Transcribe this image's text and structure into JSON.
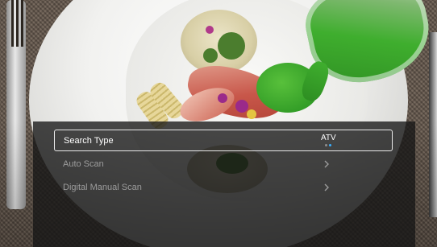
{
  "menu": {
    "items": [
      {
        "label": "Search Type",
        "value": "ATV",
        "value_options_total": 2,
        "value_selected_index": 1
      },
      {
        "label": "Auto Scan",
        "icon": "chevron-right-icon"
      },
      {
        "label": "Digital Manual Scan",
        "icon": "chevron-right-icon"
      }
    ]
  },
  "colors": {
    "menu_background": "#161616",
    "selected_border": "#eaeaea",
    "dim_text": "#9c9c9c",
    "active_dot": "#3ab0ff"
  }
}
